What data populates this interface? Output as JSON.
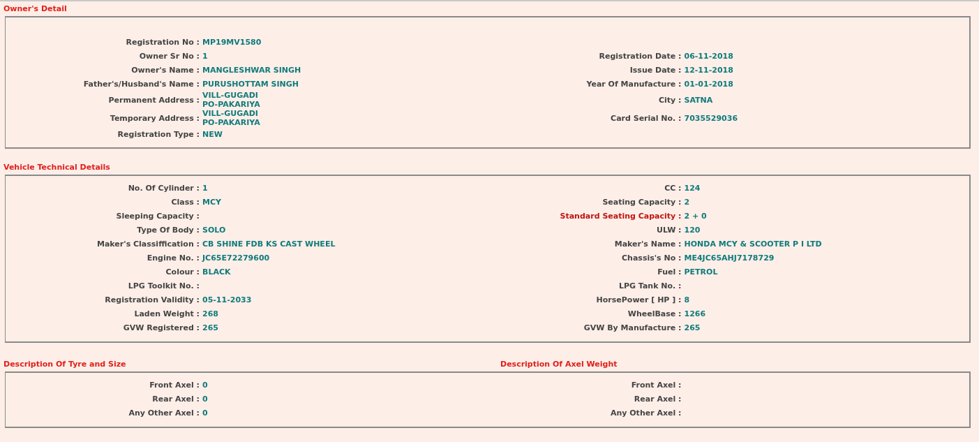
{
  "owners_detail": {
    "title": "Owner's Detail",
    "rows": [
      {
        "left": {
          "label": "Registration No :",
          "value": [
            "MP19MV1580"
          ]
        }
      },
      {
        "left": {
          "label": "Owner Sr No :",
          "value": [
            "1"
          ]
        },
        "right": {
          "label": "Registration Date :",
          "value": [
            "06-11-2018"
          ]
        }
      },
      {
        "left": {
          "label": "Owner's Name :",
          "value": [
            "MANGLESHWAR SINGH"
          ]
        },
        "right": {
          "label": "Issue Date :",
          "value": [
            "12-11-2018"
          ]
        }
      },
      {
        "left": {
          "label": "Father's/Husband's Name :",
          "value": [
            "PURUSHOTTAM SINGH"
          ]
        },
        "right": {
          "label": "Year Of Manufacture :",
          "value": [
            "01-01-2018"
          ]
        }
      },
      {
        "left": {
          "label": "Permanent Address :",
          "value": [
            "VILL-GUGADI",
            "PO-PAKARIYA"
          ]
        },
        "right": {
          "label": "City :",
          "value": [
            "SATNA"
          ]
        }
      },
      {
        "left": {
          "label": "Temporary Address :",
          "value": [
            "VILL-GUGADI",
            "PO-PAKARIYA"
          ]
        },
        "right": {
          "label": "Card Serial No. :",
          "value": [
            "7035529036"
          ]
        }
      },
      {
        "left": {
          "label": "Registration Type :",
          "value": [
            "NEW"
          ]
        }
      }
    ]
  },
  "vehicle_technical_details": {
    "title": "Vehicle Technical Details",
    "rows": [
      {
        "left": {
          "label": "No. Of Cylinder :",
          "value": [
            "1"
          ]
        },
        "right": {
          "label": "CC :",
          "value": [
            "124"
          ]
        }
      },
      {
        "left": {
          "label": "Class :",
          "value": [
            "MCY"
          ]
        },
        "right": {
          "label": "Seating Capacity :",
          "value": [
            "2"
          ]
        }
      },
      {
        "left": {
          "label": "Sleeping Capacity :"
        },
        "right": {
          "label": "Standard Seating Capacity :",
          "value": [
            "2 + 0"
          ],
          "highlighted": true
        }
      },
      {
        "left": {
          "label": "Type Of Body :",
          "value": [
            "SOLO"
          ]
        },
        "right": {
          "label": "ULW :",
          "value": [
            "120"
          ]
        }
      },
      {
        "left": {
          "label": "Maker's Classiffication :",
          "value": [
            "CB SHINE FDB KS CAST WHEEL"
          ]
        },
        "right": {
          "label": "Maker's Name :",
          "value": [
            "HONDA MCY & SCOOTER P I LTD"
          ]
        }
      },
      {
        "left": {
          "label": "Engine No. :",
          "value": [
            "JC65E72279600"
          ]
        },
        "right": {
          "label": "Chassis's No :",
          "value": [
            "ME4JC65AHJ7178729"
          ]
        }
      },
      {
        "left": {
          "label": "Colour :",
          "value": [
            "BLACK"
          ]
        },
        "right": {
          "label": "Fuel :",
          "value": [
            "PETROL"
          ]
        }
      },
      {
        "left": {
          "label": "LPG Toolkit No. :"
        },
        "right": {
          "label": "LPG Tank No. :"
        }
      },
      {
        "left": {
          "label": "Registration Validity :",
          "value": [
            "05-11-2033"
          ]
        },
        "right": {
          "label": "HorsePower [ HP ] :",
          "value": [
            "8"
          ]
        }
      },
      {
        "left": {
          "label": "Laden Weight :",
          "value": [
            "268"
          ]
        },
        "right": {
          "label": "WheelBase :",
          "value": [
            "1266"
          ]
        }
      },
      {
        "left": {
          "label": "GVW Registered :",
          "value": [
            "265"
          ]
        },
        "right": {
          "label": "GVW By Manufacture :",
          "value": [
            "265"
          ]
        }
      }
    ]
  },
  "tyre_and_axel": {
    "left_title": "Description Of Tyre and Size",
    "right_title": "Description Of Axel Weight",
    "rows": [
      {
        "left": {
          "label": "Front Axel :",
          "value": [
            "0"
          ]
        },
        "right": {
          "label": "Front Axel :"
        }
      },
      {
        "left": {
          "label": "Rear Axel :",
          "value": [
            "0"
          ]
        },
        "right": {
          "label": "Rear Axel :"
        }
      },
      {
        "left": {
          "label": "Any Other Axel :",
          "value": [
            "0"
          ]
        },
        "right": {
          "label": "Any Other Axel :"
        }
      }
    ]
  }
}
